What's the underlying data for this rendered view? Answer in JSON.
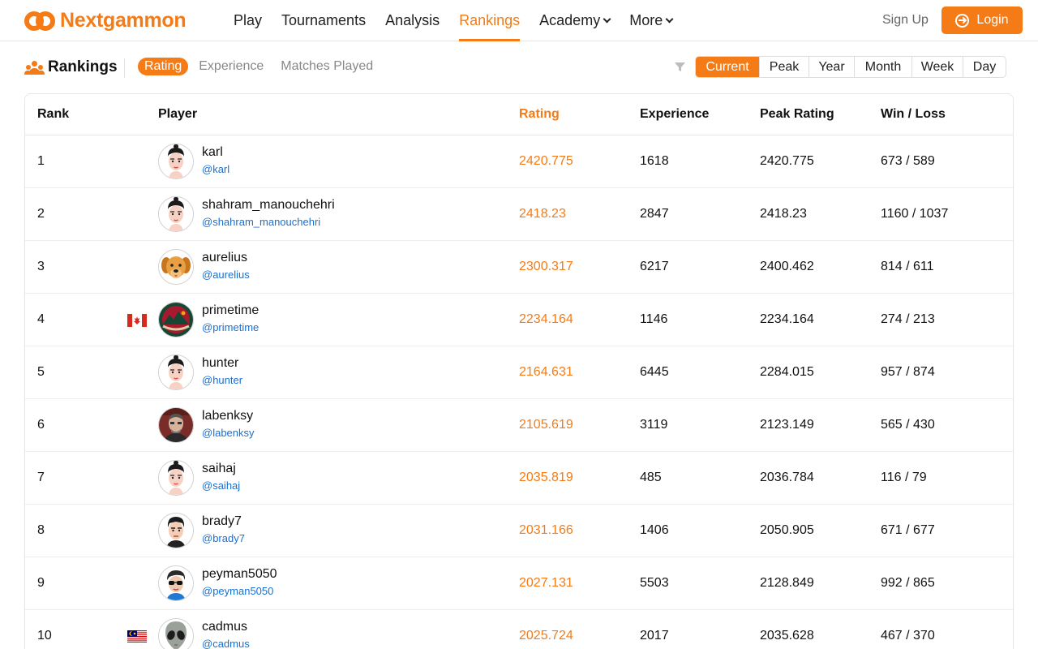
{
  "brand": {
    "name": "Nextgammon",
    "accent": "#f47b16",
    "link": "#1a6fd1"
  },
  "nav": [
    {
      "label": "Play",
      "active": false,
      "dropdown": false
    },
    {
      "label": "Tournaments",
      "active": false,
      "dropdown": false
    },
    {
      "label": "Analysis",
      "active": false,
      "dropdown": false
    },
    {
      "label": "Rankings",
      "active": true,
      "dropdown": false
    },
    {
      "label": "Academy",
      "active": false,
      "dropdown": true
    },
    {
      "label": "More",
      "active": false,
      "dropdown": true
    }
  ],
  "auth": {
    "signup": "Sign Up",
    "login": "Login"
  },
  "toolbar": {
    "title": "Rankings",
    "metric_tabs": [
      {
        "label": "Rating",
        "active": true
      },
      {
        "label": "Experience",
        "active": false
      },
      {
        "label": "Matches Played",
        "active": false
      }
    ],
    "periods": [
      {
        "label": "Current",
        "active": true
      },
      {
        "label": "Peak",
        "active": false
      },
      {
        "label": "Year",
        "active": false
      },
      {
        "label": "Month",
        "active": false
      },
      {
        "label": "Week",
        "active": false
      },
      {
        "label": "Day",
        "active": false
      }
    ]
  },
  "table": {
    "headers": {
      "rank": "Rank",
      "player": "Player",
      "rating": "Rating",
      "experience": "Experience",
      "peak": "Peak Rating",
      "winloss": "Win / Loss"
    },
    "rows": [
      {
        "rank": "1",
        "name": "karl",
        "handle": "@karl",
        "rating": "2420.775",
        "experience": "1618",
        "peak": "2420.775",
        "winloss": "673 / 589",
        "avatar": "face-icon",
        "flag": ""
      },
      {
        "rank": "2",
        "name": "shahram_manouchehri",
        "handle": "@shahram_manouchehri",
        "rating": "2418.23",
        "experience": "2847",
        "peak": "2418.23",
        "winloss": "1160 / 1037",
        "avatar": "face-icon",
        "flag": ""
      },
      {
        "rank": "3",
        "name": "aurelius",
        "handle": "@aurelius",
        "rating": "2300.317",
        "experience": "6217",
        "peak": "2400.462",
        "winloss": "814 / 611",
        "avatar": "dog-icon",
        "flag": ""
      },
      {
        "rank": "4",
        "name": "primetime",
        "handle": "@primetime",
        "rating": "2234.164",
        "experience": "1146",
        "peak": "2234.164",
        "winloss": "274 / 213",
        "avatar": "team-logo-icon",
        "flag": "canada-flag-icon"
      },
      {
        "rank": "5",
        "name": "hunter",
        "handle": "@hunter",
        "rating": "2164.631",
        "experience": "6445",
        "peak": "2284.015",
        "winloss": "957 / 874",
        "avatar": "face-icon",
        "flag": ""
      },
      {
        "rank": "6",
        "name": "labenksy",
        "handle": "@labenksy",
        "rating": "2105.619",
        "experience": "3119",
        "peak": "2123.149",
        "winloss": "565 / 430",
        "avatar": "photo-icon",
        "flag": ""
      },
      {
        "rank": "7",
        "name": "saihaj",
        "handle": "@saihaj",
        "rating": "2035.819",
        "experience": "485",
        "peak": "2036.784",
        "winloss": "116 / 79",
        "avatar": "face-icon",
        "flag": ""
      },
      {
        "rank": "8",
        "name": "brady7",
        "handle": "@brady7",
        "rating": "2031.166",
        "experience": "1406",
        "peak": "2050.905",
        "winloss": "671 / 677",
        "avatar": "face-male-icon",
        "flag": ""
      },
      {
        "rank": "9",
        "name": "peyman5050",
        "handle": "@peyman5050",
        "rating": "2027.131",
        "experience": "5503",
        "peak": "2128.849",
        "winloss": "992 / 865",
        "avatar": "sunglasses-face-icon",
        "flag": ""
      },
      {
        "rank": "10",
        "name": "cadmus",
        "handle": "@cadmus",
        "rating": "2025.724",
        "experience": "2017",
        "peak": "2035.628",
        "winloss": "467 / 370",
        "avatar": "alien-icon",
        "flag": "malaysia-flag-icon"
      }
    ]
  }
}
